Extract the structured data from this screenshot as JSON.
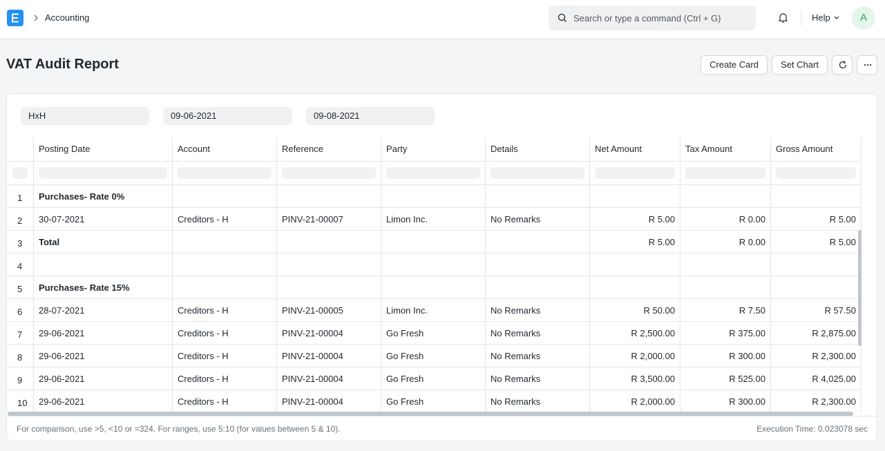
{
  "navbar": {
    "breadcrumb": "Accounting",
    "search_placeholder": "Search or type a command (Ctrl + G)",
    "help_label": "Help",
    "avatar_initial": "A"
  },
  "page": {
    "title": "VAT Audit Report",
    "buttons": {
      "create_card": "Create Card",
      "set_chart": "Set Chart"
    }
  },
  "filters": {
    "company": "HxH",
    "from_date": "09-06-2021",
    "to_date": "09-08-2021"
  },
  "table": {
    "columns": [
      "Posting Date",
      "Account",
      "Reference",
      "Party",
      "Details",
      "Net Amount",
      "Tax Amount",
      "Gross Amount"
    ],
    "rows": [
      {
        "no": "1",
        "posting_date": "Purchases- Rate 0%",
        "account": "",
        "reference": "",
        "party": "",
        "details": "",
        "net": "",
        "tax": "",
        "gross": "",
        "bold": true
      },
      {
        "no": "2",
        "posting_date": "30-07-2021",
        "account": "Creditors - H",
        "reference": "PINV-21-00007",
        "party": "Limon Inc.",
        "details": "No Remarks",
        "net": "R 5.00",
        "tax": "R 0.00",
        "gross": "R 5.00",
        "bold": false
      },
      {
        "no": "3",
        "posting_date": "Total",
        "account": "",
        "reference": "",
        "party": "",
        "details": "",
        "net": "R 5.00",
        "tax": "R 0.00",
        "gross": "R 5.00",
        "bold": true
      },
      {
        "no": "4",
        "posting_date": "",
        "account": "",
        "reference": "",
        "party": "",
        "details": "",
        "net": "",
        "tax": "",
        "gross": "",
        "bold": false
      },
      {
        "no": "5",
        "posting_date": "Purchases- Rate 15%",
        "account": "",
        "reference": "",
        "party": "",
        "details": "",
        "net": "",
        "tax": "",
        "gross": "",
        "bold": true
      },
      {
        "no": "6",
        "posting_date": "28-07-2021",
        "account": "Creditors - H",
        "reference": "PINV-21-00005",
        "party": "Limon Inc.",
        "details": "No Remarks",
        "net": "R 50.00",
        "tax": "R 7.50",
        "gross": "R 57.50",
        "bold": false
      },
      {
        "no": "7",
        "posting_date": "29-06-2021",
        "account": "Creditors - H",
        "reference": "PINV-21-00004",
        "party": "Go Fresh",
        "details": "No Remarks",
        "net": "R 2,500.00",
        "tax": "R 375.00",
        "gross": "R 2,875.00",
        "bold": false
      },
      {
        "no": "8",
        "posting_date": "29-06-2021",
        "account": "Creditors - H",
        "reference": "PINV-21-00004",
        "party": "Go Fresh",
        "details": "No Remarks",
        "net": "R 2,000.00",
        "tax": "R 300.00",
        "gross": "R 2,300.00",
        "bold": false
      },
      {
        "no": "9",
        "posting_date": "29-06-2021",
        "account": "Creditors - H",
        "reference": "PINV-21-00004",
        "party": "Go Fresh",
        "details": "No Remarks",
        "net": "R 3,500.00",
        "tax": "R 525.00",
        "gross": "R 4,025.00",
        "bold": false
      },
      {
        "no": "10",
        "posting_date": "29-06-2021",
        "account": "Creditors - H",
        "reference": "PINV-21-00004",
        "party": "Go Fresh",
        "details": "No Remarks",
        "net": "R 2,000.00",
        "tax": "R 300.00",
        "gross": "R 2,300.00",
        "bold": false
      }
    ]
  },
  "footer": {
    "hint": "For comparison, use >5, <10 or =324. For ranges, use 5:10 (for values between 5 & 10).",
    "execution_time": "Execution Time: 0.023078 sec"
  },
  "icons": {
    "logo": "erpnext-logo-icon",
    "breadcrumb_separator": "chevron-right-icon",
    "search": "search-icon",
    "notifications": "bell-icon",
    "help_dropdown": "chevron-down-icon",
    "refresh": "refresh-icon",
    "more": "more-horizontal-icon"
  },
  "colors": {
    "brand": "#2490ef",
    "avatar_bg": "#e4f5e9",
    "avatar_fg": "#38a160"
  }
}
